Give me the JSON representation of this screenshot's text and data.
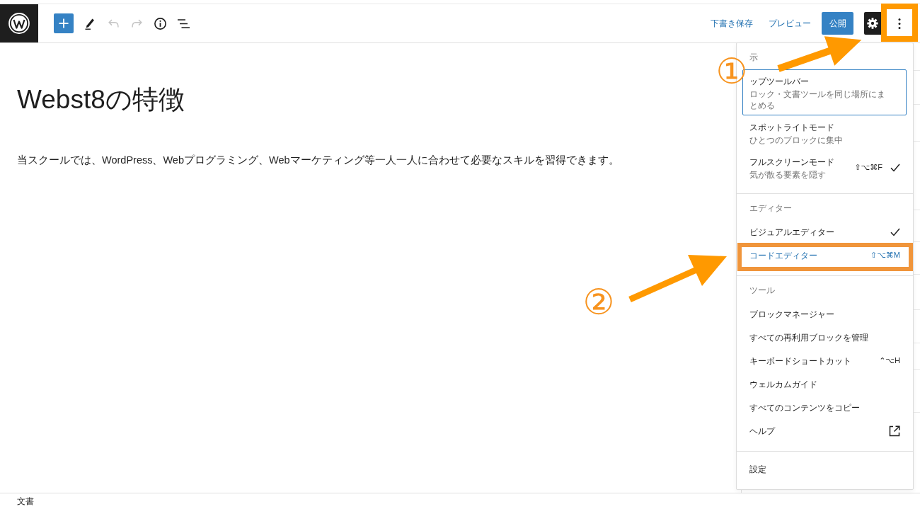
{
  "top_bar": {
    "tools": [
      {
        "kind": "add",
        "disabled": false
      },
      {
        "kind": "edit",
        "disabled": false
      },
      {
        "kind": "undo",
        "disabled": true
      },
      {
        "kind": "redo",
        "disabled": true
      },
      {
        "kind": "info",
        "disabled": false
      },
      {
        "kind": "outline",
        "disabled": false
      }
    ],
    "save_draft": "下書き保存",
    "preview": "プレビュー",
    "publish": "公開",
    "settings_button": {
      "pressed": true
    },
    "more_button": {
      "expanded": true,
      "highlighted": true
    }
  },
  "post": {
    "title": "Webst8の特徴",
    "paragraph": "当スクールでは、WordPress、Webプログラミング、Webマーケティング等一人一人に合わせて必要なスキルを習得できます。"
  },
  "menu": {
    "sections": [
      {
        "heading": "示",
        "items": [
          {
            "label": "ップツールバー",
            "description": "ロック・文書ツールを同じ場所にまとめる",
            "focused": true,
            "hovered": false,
            "checked": false,
            "external": false,
            "highlighted": false
          },
          {
            "label": "スポットライトモード",
            "description": "ひとつのブロックに集中",
            "focused": false,
            "hovered": false,
            "checked": false,
            "external": false,
            "highlighted": false
          },
          {
            "label": "フルスクリーンモード",
            "description": "気が散る要素を隠す",
            "shortcut": "⇧⌥⌘F",
            "focused": false,
            "hovered": false,
            "checked": true,
            "external": false,
            "highlighted": false
          }
        ]
      },
      {
        "heading": "エディター",
        "items": [
          {
            "label": "ビジュアルエディター",
            "focused": false,
            "hovered": false,
            "checked": true,
            "external": false,
            "highlighted": false
          },
          {
            "label": "コードエディター",
            "shortcut": "⇧⌥⌘M",
            "focused": false,
            "hovered": true,
            "checked": false,
            "external": false,
            "highlighted": true
          }
        ]
      },
      {
        "heading": "ツール",
        "items": [
          {
            "label": "ブロックマネージャー",
            "focused": false,
            "hovered": false,
            "checked": false,
            "external": false,
            "highlighted": false
          },
          {
            "label": "すべての再利用ブロックを管理",
            "focused": false,
            "hovered": false,
            "checked": false,
            "external": false,
            "highlighted": false
          },
          {
            "label": "キーボードショートカット",
            "shortcut": "⌃⌥H",
            "focused": false,
            "hovered": false,
            "checked": false,
            "external": false,
            "highlighted": false
          },
          {
            "label": "ウェルカムガイド",
            "focused": false,
            "hovered": false,
            "checked": false,
            "external": false,
            "highlighted": false
          },
          {
            "label": "すべてのコンテンツをコピー",
            "focused": false,
            "hovered": false,
            "checked": false,
            "external": false,
            "highlighted": false
          },
          {
            "label": "ヘルプ",
            "focused": false,
            "hovered": false,
            "checked": false,
            "external": true,
            "highlighted": false
          }
        ]
      },
      {
        "items": [
          {
            "label": "設定",
            "focused": false,
            "hovered": false,
            "checked": false,
            "external": false,
            "highlighted": false
          }
        ]
      }
    ]
  },
  "status_bar": {
    "breadcrumb": "文書"
  },
  "annotations": [
    {
      "label": "①"
    },
    {
      "label": "②"
    }
  ]
}
